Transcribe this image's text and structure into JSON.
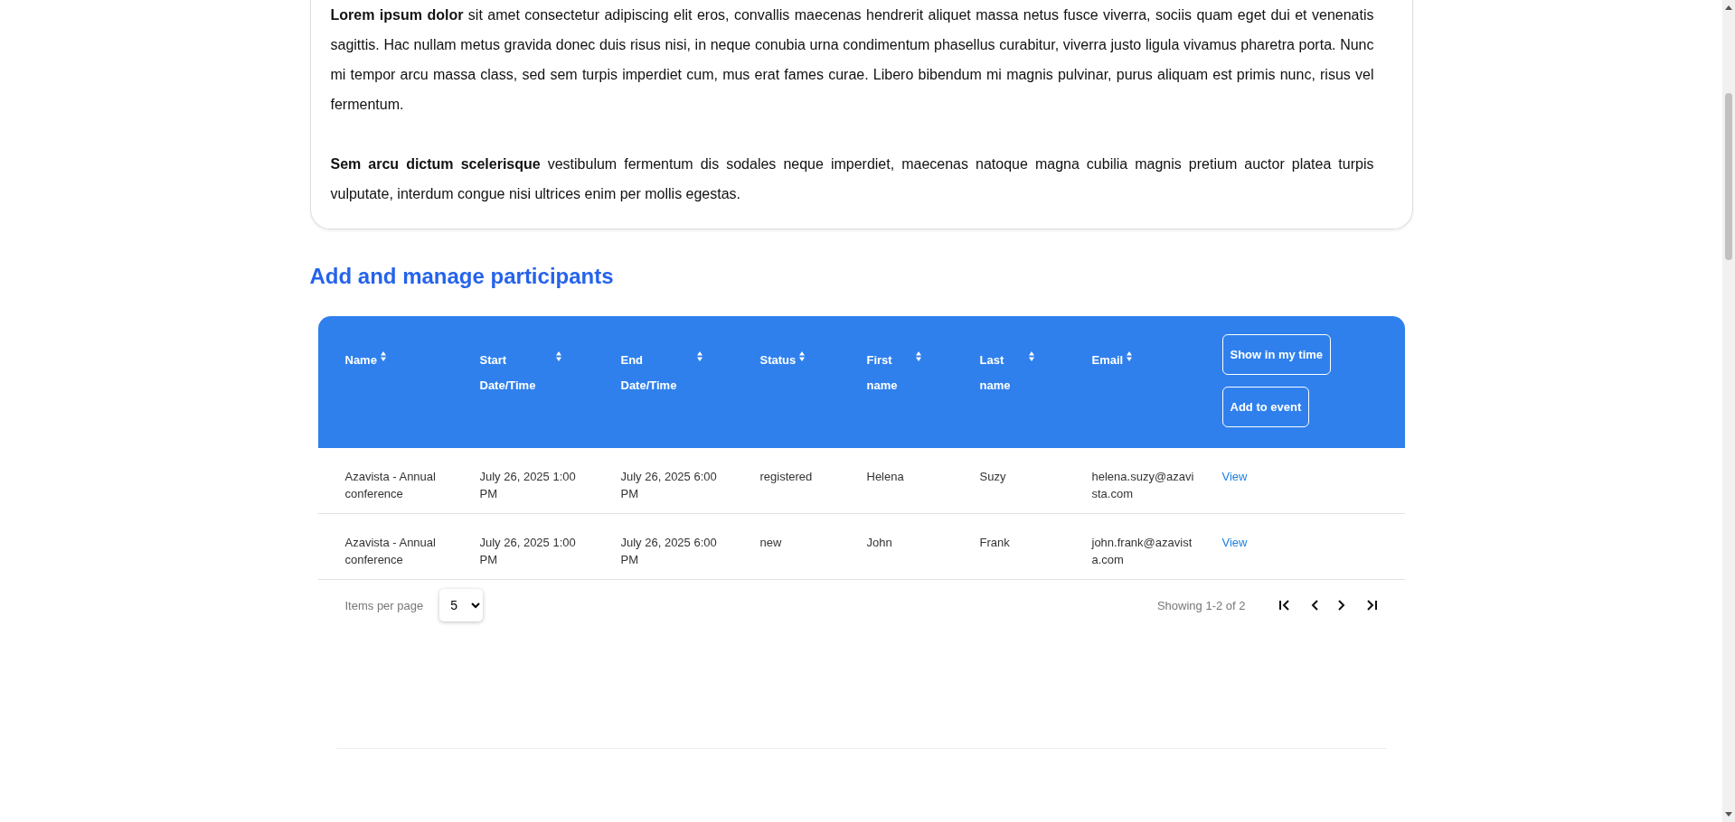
{
  "intro": {
    "paragraphs": [
      "**Lorem ipsum dolor** sit amet consectetur adipiscing elit eros, convallis maecenas hendrerit aliquet massa netus fusce viverra, sociis quam eget dui et venenatis sagittis. Hac nullam metus gravida donec duis risus nisi, in neque conubia urna condimentum phasellus curabitur, viverra justo ligula vivamus pharetra porta. Nunc mi tempor arcu massa class, sed sem turpis imperdiet cum, mus erat fames curae. Libero bibendum mi magnis pulvinar, purus aliquam est primis nunc, risus vel fermentum.",
      "**Sem arcu dictum scelerisque** vestibulum fermentum dis sodales neque imperdiet, maecenas natoque magna cubilia magnis pretium auctor platea turpis vulputate, interdum congue nisi ultrices enim per mollis egestas."
    ]
  },
  "section_title": "Add and manage participants",
  "table": {
    "columns": [
      "Name",
      "Start Date/Time",
      "End Date/Time",
      "Status",
      "First name",
      "Last name",
      "Email"
    ],
    "header_buttons": [
      "Show in my time",
      "Add to event"
    ],
    "rows": [
      {
        "name": "Azavista - Annual conference",
        "start": "July 26, 2025 1:00 PM",
        "end": "July 26, 2025 6:00 PM",
        "status": "registered",
        "first_name": "Helena",
        "last_name": "Suzy",
        "email": "helena.suzy@azavista.com",
        "action": "View"
      },
      {
        "name": "Azavista - Annual conference",
        "start": "July 26, 2025 1:00 PM",
        "end": "July 26, 2025 6:00 PM",
        "status": "new",
        "first_name": "John",
        "last_name": "Frank",
        "email": "john.frank@azavista.com",
        "action": "View"
      }
    ]
  },
  "pagination": {
    "items_per_page_label": "Items per page",
    "items_per_page": "5",
    "showing": "Showing 1-2 of 2"
  }
}
